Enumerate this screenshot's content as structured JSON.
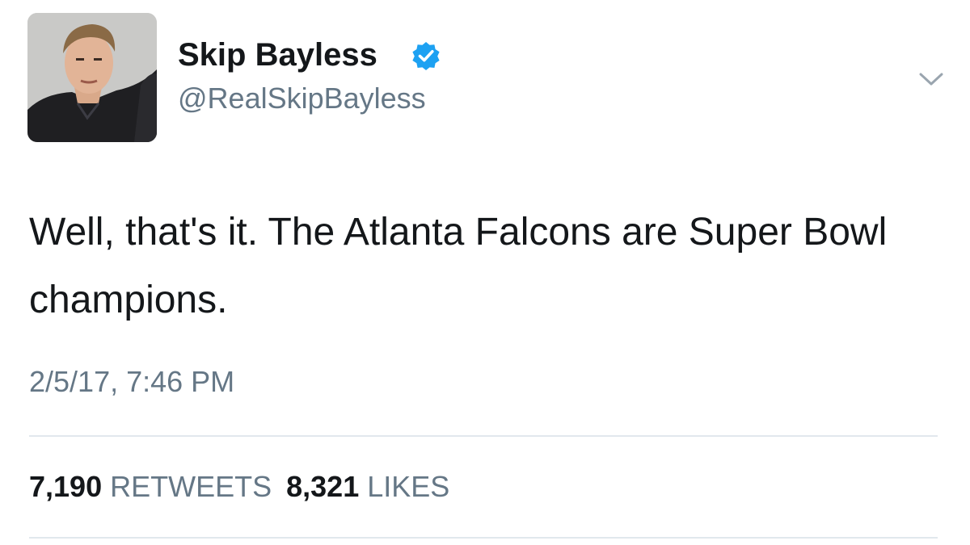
{
  "user": {
    "display_name": "Skip Bayless",
    "handle": "@RealSkipBayless",
    "verified": true
  },
  "tweet": {
    "text": "Well, that's it. The Atlanta Falcons are Super Bowl champions.",
    "timestamp": "2/5/17, 7:46 PM"
  },
  "stats": {
    "retweets_count": "7,190",
    "retweets_label": "RETWEETS",
    "likes_count": "8,321",
    "likes_label": "LIKES"
  },
  "icons": {
    "verified": "verified-badge-icon",
    "menu": "chevron-down-icon"
  },
  "colors": {
    "text_primary": "#14171a",
    "text_secondary": "#657786",
    "verified_blue": "#1da1f2",
    "divider": "#e1e8ed"
  }
}
